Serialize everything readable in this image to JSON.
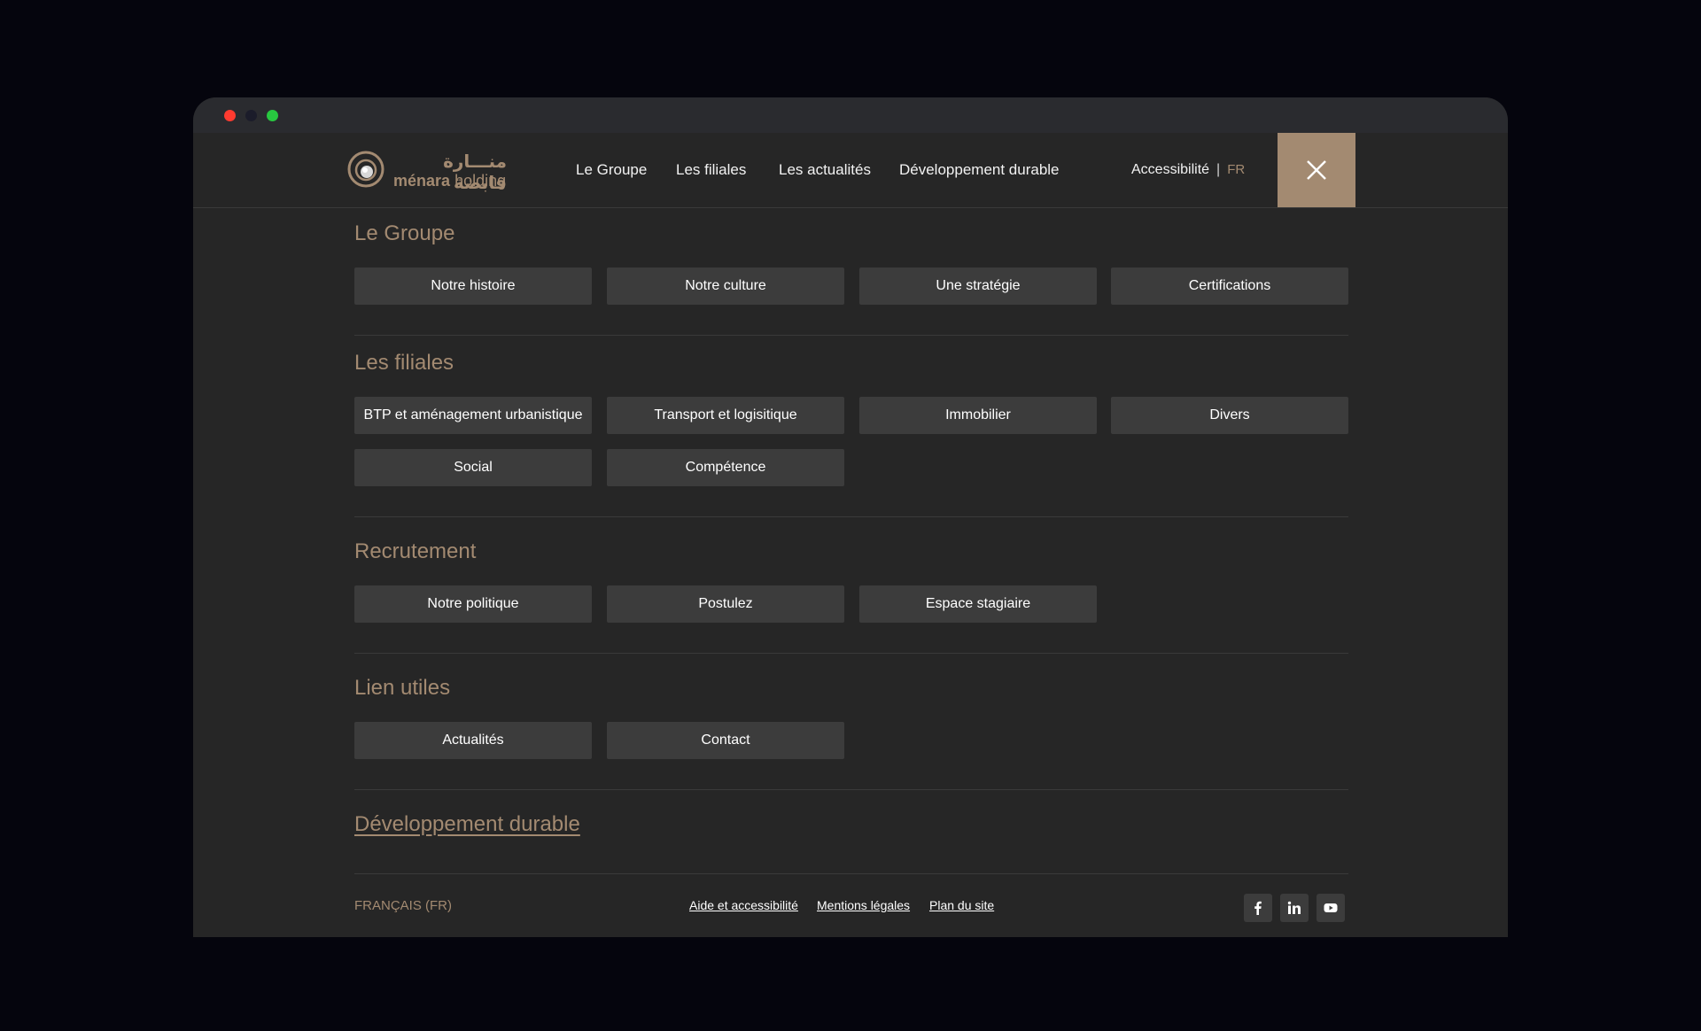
{
  "logo": {
    "arabic": "منـــارة قابضة",
    "brand_bold": "ménara",
    "brand_light": "holding"
  },
  "nav": {
    "items": [
      "Le Groupe",
      "Les filiales",
      "Les actualités",
      "Développement durable"
    ],
    "accessibility": "Accessibilité",
    "separator": "|",
    "language": "FR"
  },
  "menu": {
    "groupe": {
      "title": "Le Groupe",
      "items": [
        "Notre histoire",
        "Notre culture",
        "Une stratégie",
        "Certifications"
      ]
    },
    "filiales": {
      "title": "Les filiales",
      "items": [
        "BTP et aménagement urbanistique",
        "Transport et logisitique",
        "Immobilier",
        "Divers",
        "Social",
        "Compétence"
      ]
    },
    "recrutement": {
      "title": "Recrutement",
      "items": [
        "Notre politique",
        "Postulez",
        "Espace stagiaire"
      ]
    },
    "liens": {
      "title": "Lien utiles",
      "items": [
        "Actualités",
        "Contact"
      ]
    },
    "durable": {
      "title": "Développement durable"
    }
  },
  "footer": {
    "language": "FRANÇAIS (FR)",
    "links": [
      "Aide et accessibilité",
      "Mentions légales",
      "Plan du site"
    ],
    "social": [
      "facebook-icon",
      "linkedin-icon",
      "youtube-icon"
    ]
  },
  "colors": {
    "accent": "#a38a71",
    "background": "#262626",
    "button": "#3c3c3c",
    "outer": "#05050d"
  }
}
